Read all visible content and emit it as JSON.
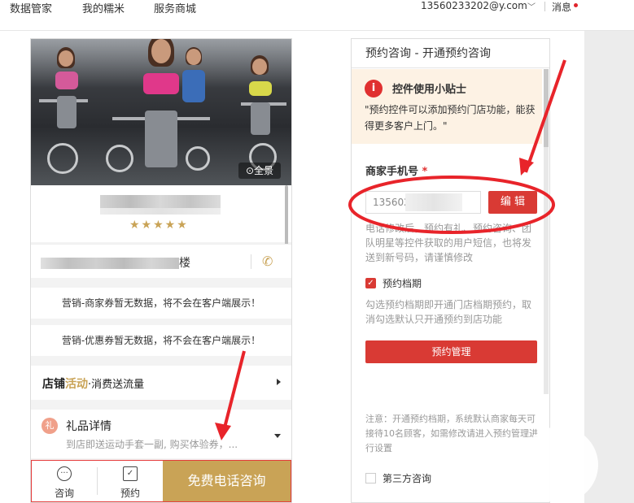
{
  "topnav": {
    "items": [
      {
        "label": "数据管家"
      },
      {
        "label": "我的糯米"
      },
      {
        "label": "服务商城"
      }
    ],
    "account": "13560233202@y.com",
    "messages": "消息"
  },
  "preview": {
    "panorama_label": "全景",
    "rating_stars": "★★★★★",
    "address_suffix": "楼",
    "notice_coupon": "营销-商家券暂无数据，将不会在客户端展示！",
    "notice_discount": "营销-优惠券暂无数据，将不会在客户端展示！",
    "activity": {
      "part1": "店铺",
      "part2": "活动",
      "part3": "·消费送流量"
    },
    "gift": {
      "icon_char": "礼",
      "title": "礼品详情",
      "desc": "到店即送运动手套一副, 购买体验券，..."
    },
    "bottom_bar": {
      "consult": "咨询",
      "booking": "预约",
      "call": "免费电话咨询"
    }
  },
  "panel": {
    "title": "预约咨询 - 开通预约咨询",
    "tip": {
      "icon": "i",
      "title": "控件使用小贴士",
      "body": "\"预约控件可以添加预约门店功能，能获得更多客户上门。\""
    },
    "phone_field": {
      "label": "商家手机号",
      "required_mark": "*",
      "value": "135602",
      "edit_button": "编 辑",
      "help": "电话修改后，预约有礼、预约咨询、团队明星等控件获取的用户短信，也将发送到新号码，请谨慎修改"
    },
    "booking_check": {
      "label": "预约档期",
      "checked": true,
      "help": "勾选预约档期即开通门店档期预约，取消勾选默认只开通预约到店功能"
    },
    "manage_button": "预约管理",
    "note": "注意：开通预约档期，系统默认商家每天可接待10名顾客，如需修改请进入预约管理进行设置",
    "third_party": "第三方咨询"
  },
  "colors": {
    "accent_red": "#d93a34",
    "gold": "#c9a356",
    "annotation_red": "#e8242a"
  }
}
